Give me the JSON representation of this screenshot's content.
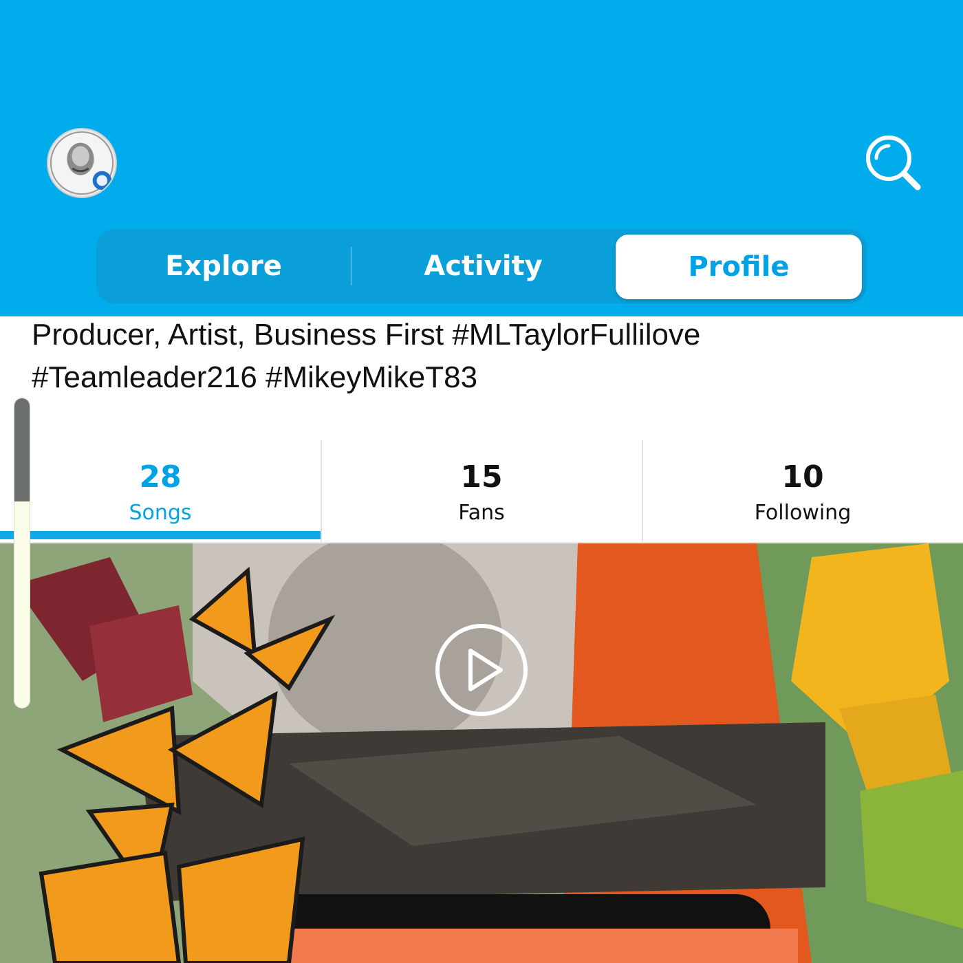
{
  "header": {
    "background_color": "#00aceb",
    "avatar_icon": "profile-avatar",
    "search_icon": "search-icon"
  },
  "tabs": [
    {
      "label": "Explore",
      "active": false
    },
    {
      "label": "Activity",
      "active": false
    },
    {
      "label": "Profile",
      "active": true
    }
  ],
  "bio": {
    "line1": "Producer, Artist, Business First #MLTaylorFullilove",
    "line2": "#Teamleader216 #MikeyMikeT83"
  },
  "stats": [
    {
      "value": "28",
      "label": "Songs",
      "active": true
    },
    {
      "value": "15",
      "label": "Fans",
      "active": false
    },
    {
      "value": "10",
      "label": "Following",
      "active": false
    }
  ],
  "accent_color": "#00a2e6",
  "artwork": {
    "play_icon": "play-icon"
  }
}
